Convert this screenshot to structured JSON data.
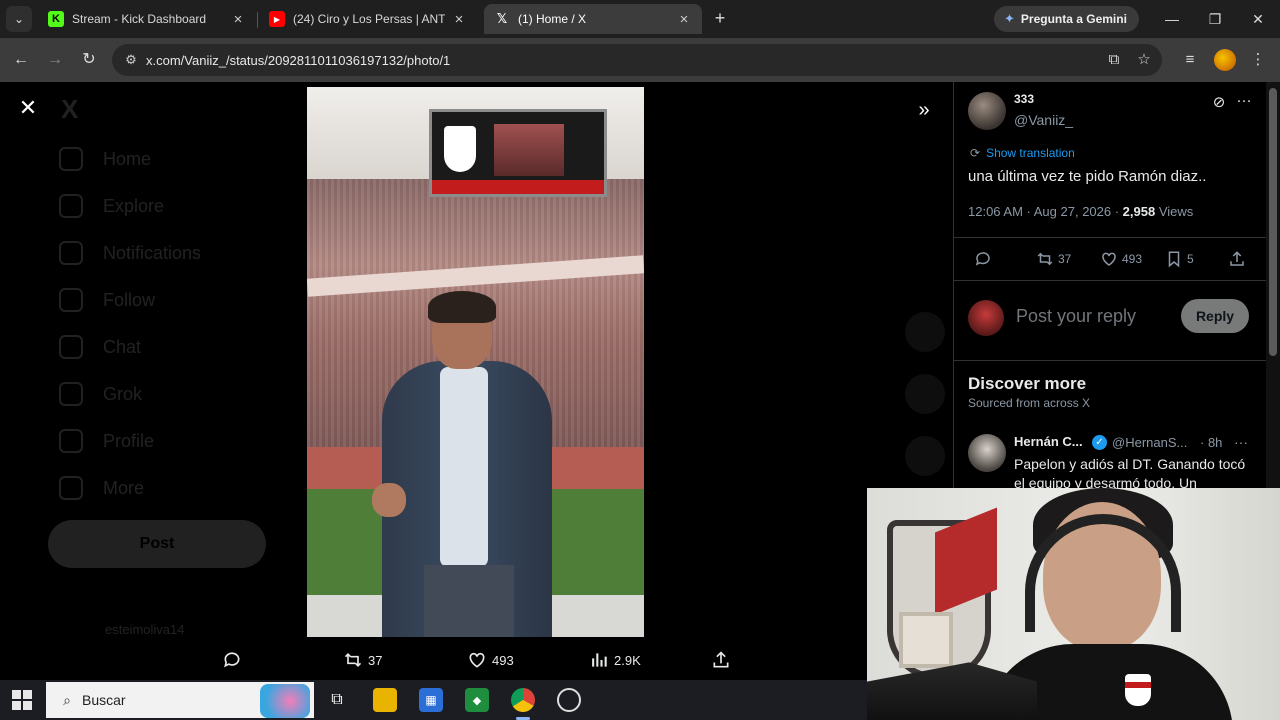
{
  "browser": {
    "tabs": [
      {
        "title": "Stream - Kick Dashboard",
        "favicon": "kick-icon",
        "active": false
      },
      {
        "title": "(24) Ciro y Los Persas | ANT",
        "favicon": "youtube-icon",
        "active": false
      },
      {
        "title": "(1) Home / X",
        "favicon": "x-icon",
        "active": true
      }
    ],
    "new_tab_label": "+",
    "gemini_label": "Pregunta a Gemini",
    "url": "x.com/Vaniiz_/status/2092811011036197132/photo/1"
  },
  "background_nav": {
    "logo": "X",
    "items": [
      "Home",
      "Explore",
      "Notifications",
      "Follow",
      "Chat",
      "Grok",
      "Profile",
      "More"
    ],
    "post_button": "Post",
    "account_name": "esteimoliva14"
  },
  "photo_actions": {
    "retweets": "37",
    "likes": "493",
    "views": "2.9K"
  },
  "tweet": {
    "display_name": "333",
    "handle": "@Vaniiz_",
    "show_translation": "Show translation",
    "text": "una última vez te pido Ramón diaz..",
    "time_date": "12:06 AM · Aug 27, 2026 · ",
    "views_count": "2,958",
    "views_label": " Views",
    "retweets": "37",
    "likes": "493",
    "bookmarks": "5"
  },
  "reply": {
    "placeholder": "Post your reply",
    "button": "Reply"
  },
  "discover": {
    "title": "Discover more",
    "subtitle": "Sourced from across X",
    "related": {
      "name": "Hernán C...",
      "handle": "@HernanS...",
      "time": "· 8h",
      "text": "Papelon y adiós al DT. Ganando tocó el equipo y desarmó todo. Un"
    }
  },
  "taskbar": {
    "search_label": "Buscar"
  },
  "colors": {
    "x_blue": "#1d9bf0",
    "text_primary": "#e7e9ea",
    "text_secondary": "#8b98a5",
    "chrome_tabbar": "#1f1f1f",
    "chrome_toolbar": "#3c3c3c"
  }
}
